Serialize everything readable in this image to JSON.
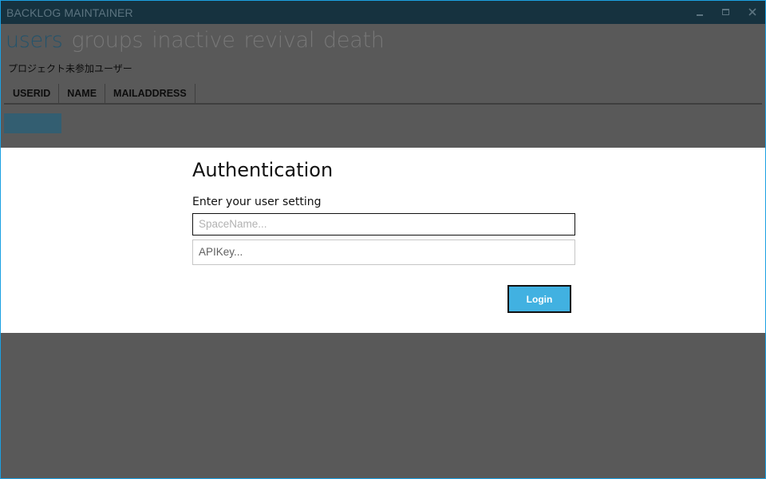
{
  "window": {
    "title": "BACKLOG MAINTAINER",
    "accent_color": "#1ba1e2",
    "titlebar_color": "#16323f"
  },
  "nav": {
    "items": [
      {
        "label": "users",
        "active": true
      },
      {
        "label": "groups",
        "active": false
      },
      {
        "label": "inactive",
        "active": false
      },
      {
        "label": "revival",
        "active": false
      },
      {
        "label": "death",
        "active": false
      }
    ]
  },
  "main": {
    "subtitle": "プロジェクト未参加ユーザー",
    "table": {
      "columns": [
        "USERID",
        "NAME",
        "MAILADDRESS"
      ],
      "rows": []
    }
  },
  "dialog": {
    "title": "Authentication",
    "subtitle": "Enter your user setting",
    "space_name": {
      "value": "",
      "placeholder": "SpaceName..."
    },
    "api_key": {
      "value": "",
      "placeholder": "APIKey..."
    },
    "login_label": "Login",
    "login_color": "#41b1e1"
  },
  "icons": {
    "minimize": "minimize-icon",
    "maximize": "maximize-icon",
    "close": "close-icon"
  }
}
